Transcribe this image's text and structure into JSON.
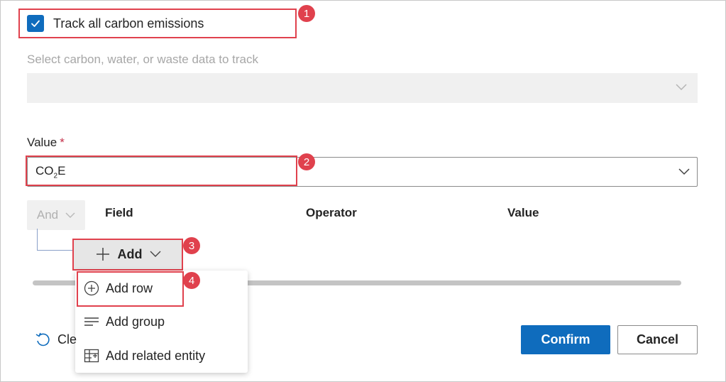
{
  "track": {
    "label": "Track all carbon emissions",
    "checked": true
  },
  "data_select": {
    "label": "Select carbon, water, or waste data to track",
    "value": ""
  },
  "value_field": {
    "label": "Value",
    "required_mark": "*",
    "value_main": "CO",
    "value_sub": "2",
    "value_tail": "E"
  },
  "filter": {
    "and_label": "And",
    "columns": [
      "Field",
      "Operator",
      "Value"
    ],
    "add_label": "Add"
  },
  "menu": {
    "items": [
      {
        "label": "Add row",
        "icon": "add-circle-icon"
      },
      {
        "label": "Add group",
        "icon": "lines-icon"
      },
      {
        "label": "Add related entity",
        "icon": "table-link-icon"
      }
    ]
  },
  "footer": {
    "clear_label": "Cle",
    "confirm_label": "Confirm",
    "cancel_label": "Cancel"
  },
  "annotations": [
    "1",
    "2",
    "3",
    "4"
  ],
  "colors": {
    "accent": "#0f6cbd",
    "highlight": "#e0414d"
  }
}
